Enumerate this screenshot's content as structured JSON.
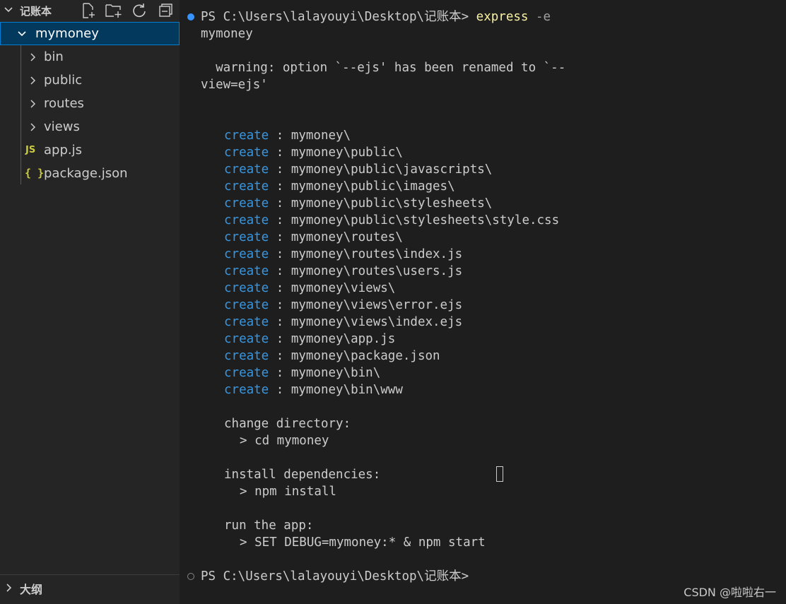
{
  "explorer": {
    "folder_title": "记账本",
    "actions": [
      "new-file-icon",
      "new-folder-icon",
      "refresh-icon",
      "collapse-all-icon"
    ],
    "tree": [
      {
        "label": "mymoney",
        "type": "folder",
        "expanded": true,
        "selected": true
      },
      {
        "label": "bin",
        "type": "folder",
        "expanded": false
      },
      {
        "label": "public",
        "type": "folder",
        "expanded": false
      },
      {
        "label": "routes",
        "type": "folder",
        "expanded": false
      },
      {
        "label": "views",
        "type": "folder",
        "expanded": false
      },
      {
        "label": "app.js",
        "type": "file",
        "icon_text": "JS"
      },
      {
        "label": "package.json",
        "type": "file",
        "icon_text": "{ }"
      }
    ],
    "outline_title": "大纲"
  },
  "terminal": {
    "prompt": "PS C:\\Users\\lalayouyi\\Desktop\\记账本>",
    "command": "express",
    "flag": "-e",
    "command_wrap": "mymoney",
    "warning_line1": "  warning: option `--ejs' has been renamed to `--",
    "warning_line2": "view=ejs'",
    "create_keyword": "create",
    "created_paths": [
      "mymoney\\",
      "mymoney\\public\\",
      "mymoney\\public\\javascripts\\",
      "mymoney\\public\\images\\",
      "mymoney\\public\\stylesheets\\",
      "mymoney\\public\\stylesheets\\style.css",
      "mymoney\\routes\\",
      "mymoney\\routes\\index.js",
      "mymoney\\routes\\users.js",
      "mymoney\\views\\",
      "mymoney\\views\\error.ejs",
      "mymoney\\views\\index.ejs",
      "mymoney\\app.js",
      "mymoney\\package.json",
      "mymoney\\bin\\",
      "mymoney\\bin\\www"
    ],
    "change_dir_label": "change directory:",
    "change_dir_cmd": "> cd mymoney",
    "install_label": "install dependencies:",
    "install_cmd": "> npm install",
    "run_label": "run the app:",
    "run_cmd": "> SET DEBUG=mymoney:* & npm start",
    "final_prompt": "PS C:\\Users\\lalayouyi\\Desktop\\记账本>"
  },
  "watermark": "CSDN @啦啦右一",
  "colors": {
    "background": "#1e1e1e",
    "sidebar": "#252526",
    "selection": "#04395e",
    "create_keyword": "#3a96dd",
    "executable": "#f9f1a5",
    "js_icon": "#cbcb41"
  }
}
